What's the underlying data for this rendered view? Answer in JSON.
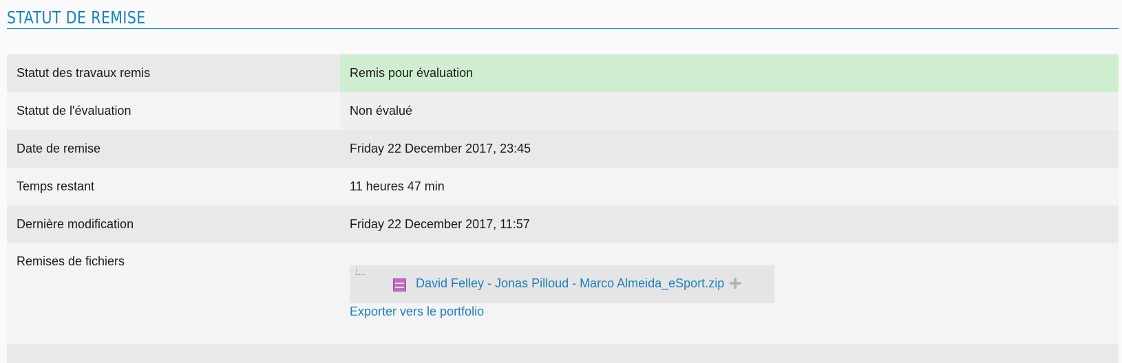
{
  "heading": "STATUT DE REMISE",
  "rows": [
    {
      "label": "Statut des travaux remis",
      "value": "Remis pour évaluation"
    },
    {
      "label": "Statut de l'évaluation",
      "value": "Non évalué"
    },
    {
      "label": "Date de remise",
      "value": "Friday 22 December 2017, 23:45"
    },
    {
      "label": "Temps restant",
      "value": "11 heures 47 min"
    },
    {
      "label": "Dernière modification",
      "value": "Friday 22 December 2017, 11:57"
    }
  ],
  "files": {
    "label": "Remises de fichiers",
    "file_name": "David Felley - Jonas Pilloud - Marco Almeida_eSport.zip",
    "file_icon": "archive-zip-icon",
    "add_icon": "plus-icon",
    "export_link": "Exporter vers le portfolio"
  },
  "colors": {
    "accent": "#1582c0",
    "link": "#1a80bf",
    "submitted_bg": "#cfeed0",
    "row_dark": "#e9e9e9",
    "row_light": "#f4f4f4"
  }
}
